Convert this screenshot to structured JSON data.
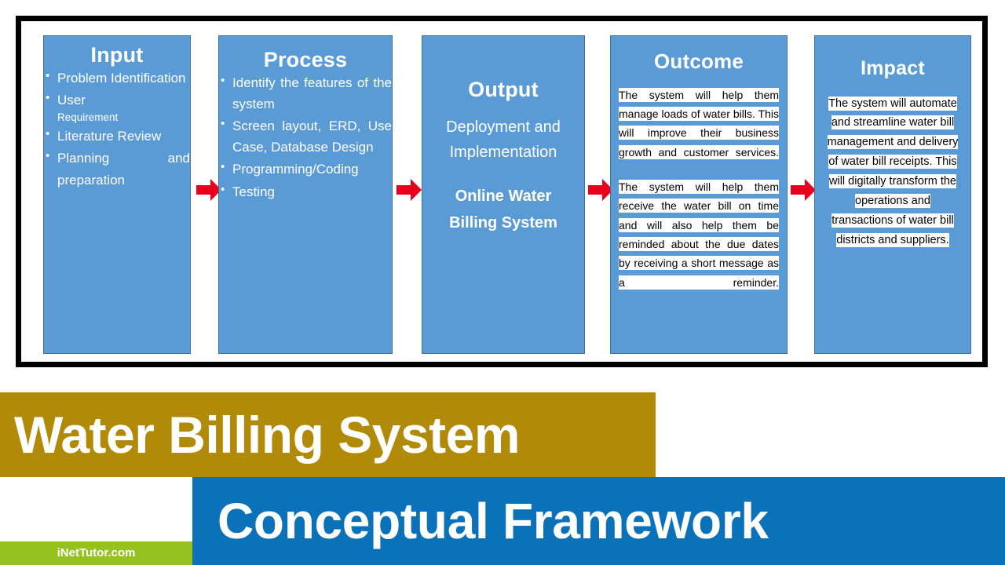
{
  "diagram": {
    "columns": [
      {
        "title": "Input",
        "type": "bullets",
        "items": [
          {
            "text": "Problem Identification"
          },
          {
            "text": "User",
            "sub": "Requirement"
          },
          {
            "text": "Literature Review"
          },
          {
            "text": "Planning and preparation"
          }
        ]
      },
      {
        "title": "Process",
        "type": "bullets",
        "items": [
          {
            "text": "Identify the features of the system"
          },
          {
            "text": "Screen layout, ERD, Use Case, Database Design"
          },
          {
            "text": "Programming/Coding"
          },
          {
            "text": "Testing"
          }
        ]
      },
      {
        "title": "Output",
        "type": "text",
        "paragraph": "Deployment and Implementation",
        "strong": "Online Water Billing System"
      },
      {
        "title": "Outcome",
        "type": "highlight",
        "paragraphs": [
          "The system will help them manage loads of water bills. This will improve their business growth and customer services.",
          "The system will help them receive the water bill on time and will also help them be reminded about the due dates by receiving a short message as a reminder."
        ]
      },
      {
        "title": "Impact",
        "type": "highlight",
        "paragraphs": [
          "The system will automate and streamline water bill management and delivery of water bill receipts. This will digitally transform the operations and transactions of water bill districts and suppliers."
        ]
      }
    ],
    "arrows": [
      {
        "name": "arrow-input-to-process"
      },
      {
        "name": "arrow-process-to-output"
      },
      {
        "name": "arrow-output-to-outcome"
      },
      {
        "name": "arrow-outcome-to-impact"
      }
    ]
  },
  "banners": {
    "gold_title": "Water Billing System",
    "blue_title": "Conceptual Framework",
    "brand": "iNetTutor.com"
  },
  "colors": {
    "box_fill": "#5b9bd5",
    "box_border": "#41719c",
    "arrow": "#e8001c",
    "gold": "#b08a08",
    "blue": "#0b72ba",
    "green": "#97c11f",
    "frame": "#000000"
  }
}
